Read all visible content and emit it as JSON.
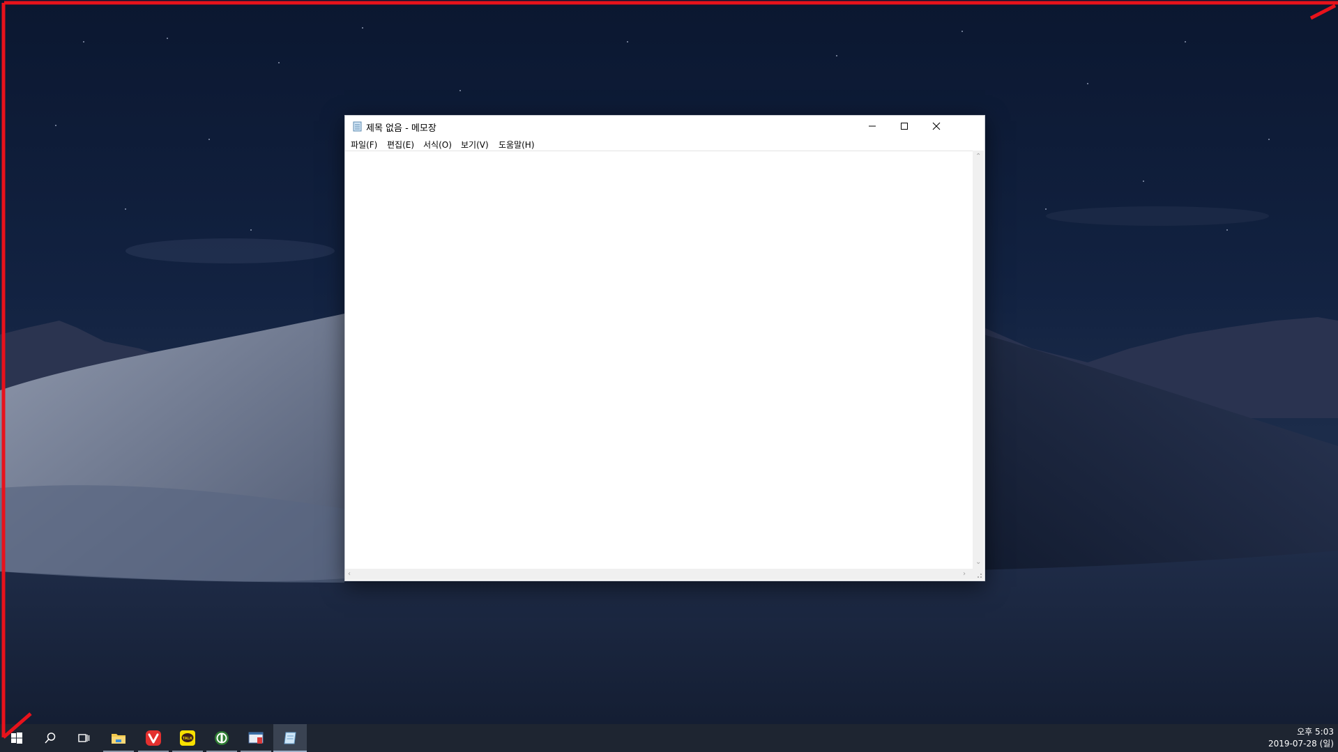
{
  "window": {
    "title": "제목 없음 - 메모장",
    "menu": [
      "파일(F)",
      "편집(E)",
      "서식(O)",
      "보기(V)",
      "도움말(H)"
    ],
    "content": ""
  },
  "taskbar": {
    "items": [
      {
        "name": "start-button",
        "icon": "windows-logo-icon"
      },
      {
        "name": "search-button",
        "icon": "search-icon"
      },
      {
        "name": "task-view-button",
        "icon": "task-view-icon"
      },
      {
        "name": "file-explorer-button",
        "icon": "folder-icon"
      },
      {
        "name": "vivaldi-button",
        "icon": "vivaldi-icon"
      },
      {
        "name": "kakaotalk-button",
        "icon": "kakaotalk-icon"
      },
      {
        "name": "app-green-button",
        "icon": "green-app-icon"
      },
      {
        "name": "app-screenshot-button",
        "icon": "screenshot-app-icon"
      },
      {
        "name": "notepad-taskbar-button",
        "icon": "notepad-icon"
      }
    ],
    "kakaotalk_label": "TALK",
    "clock": {
      "time": "오후 5:03",
      "date": "2019-07-28 (일)"
    }
  },
  "colors": {
    "annotation": "#e8121b",
    "taskbar": "#1e2531",
    "desktop_sky": "#122241"
  }
}
